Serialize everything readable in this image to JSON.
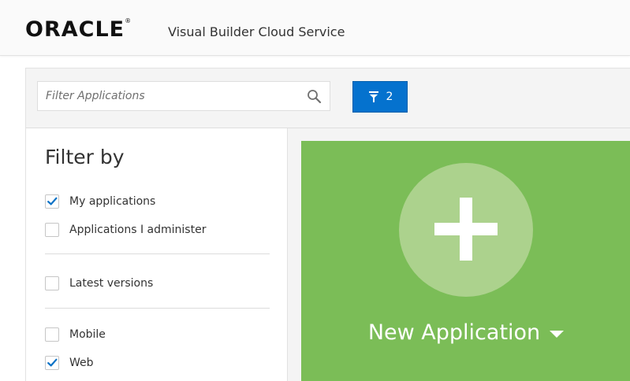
{
  "header": {
    "logo_text": "ORACLE",
    "registered_mark": "®",
    "product_name": "Visual Builder Cloud Service"
  },
  "search": {
    "placeholder": "Filter Applications",
    "value": "",
    "icon": "search-icon"
  },
  "filter_button": {
    "icon": "filter-icon",
    "count": "2",
    "color": "#0572ce"
  },
  "filter_panel": {
    "title": "Filter by",
    "groups": [
      {
        "options": [
          {
            "label": "My applications",
            "checked": true
          },
          {
            "label": "Applications I administer",
            "checked": false
          }
        ]
      },
      {
        "options": [
          {
            "label": "Latest versions",
            "checked": false
          }
        ]
      },
      {
        "options": [
          {
            "label": "Mobile",
            "checked": false
          },
          {
            "label": "Web",
            "checked": true
          }
        ]
      }
    ]
  },
  "new_application": {
    "label": "New Application",
    "icon": "plus-icon",
    "dropdown_icon": "chevron-down-icon",
    "color": "#7bbd57"
  },
  "colors": {
    "accent": "#0572ce",
    "checkmark": "#0b72c6",
    "card": "#7bbd57"
  }
}
